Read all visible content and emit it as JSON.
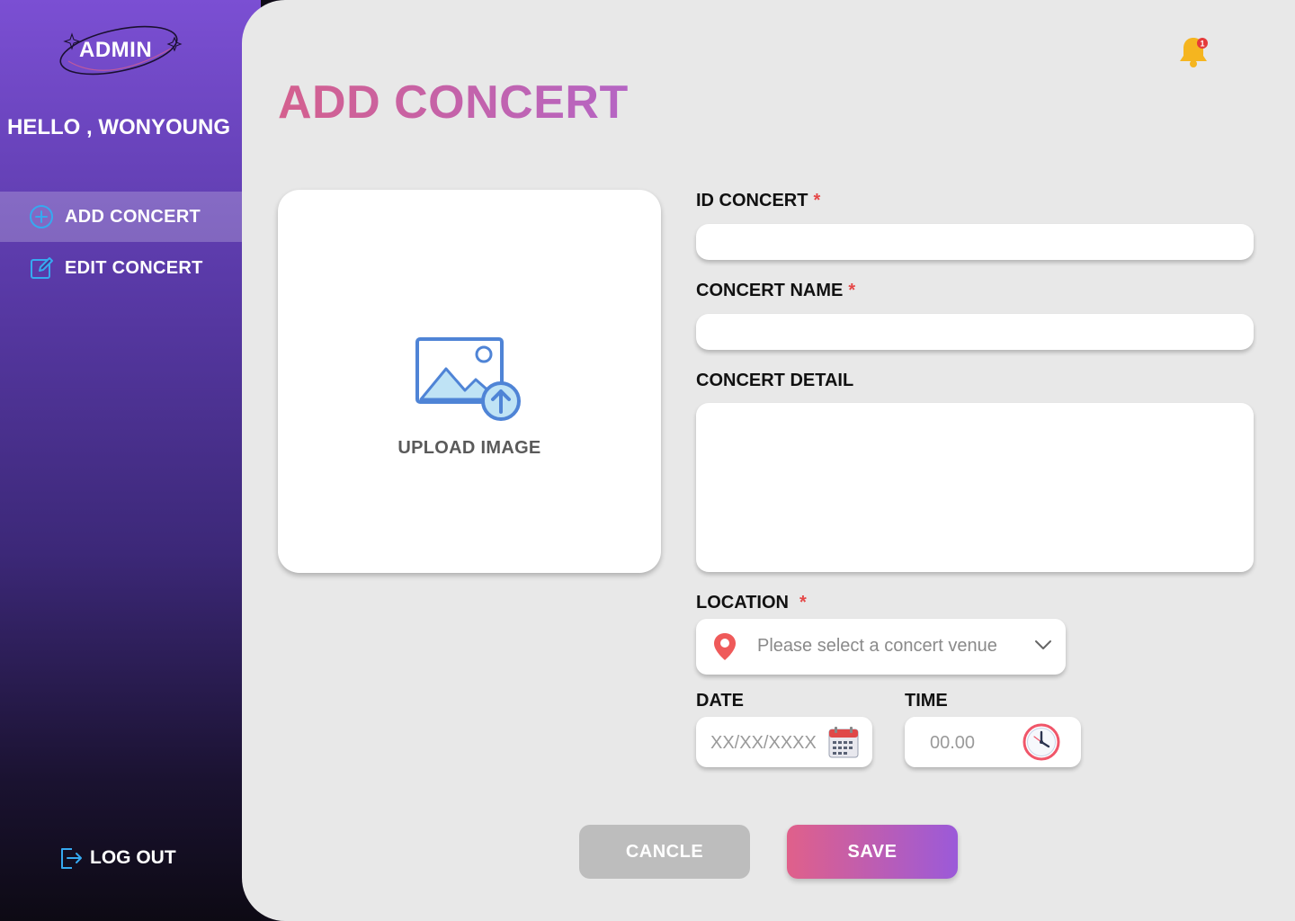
{
  "sidebar": {
    "logo_text": "ADMIN",
    "greeting": "HELLO , WONYOUNG",
    "items": [
      {
        "label": "ADD CONCERT",
        "icon": "plus-circle-icon",
        "active": true
      },
      {
        "label": "EDIT CONCERT",
        "icon": "edit-icon",
        "active": false
      }
    ],
    "logout_label": "LOG OUT"
  },
  "header": {
    "notification_count": "1"
  },
  "main": {
    "title": "ADD CONCERT",
    "upload_label": "UPLOAD IMAGE",
    "fields": {
      "id_label": "ID CONCERT",
      "name_label": "CONCERT NAME",
      "detail_label": "CONCERT DETAIL",
      "location_label": "LOCATION",
      "location_placeholder": "Please select a concert venue",
      "date_label": "DATE",
      "date_placeholder": "XX/XX/XXXX",
      "time_label": "TIME",
      "time_placeholder": "00.00",
      "required_mark": "*"
    },
    "buttons": {
      "cancel": "CANCLE",
      "save": "SAVE"
    }
  },
  "colors": {
    "accent_gradient_start": "#d4608e",
    "accent_gradient_end": "#9b5ad9",
    "required": "#e54848",
    "sidebar_top": "#7b4fd3"
  }
}
